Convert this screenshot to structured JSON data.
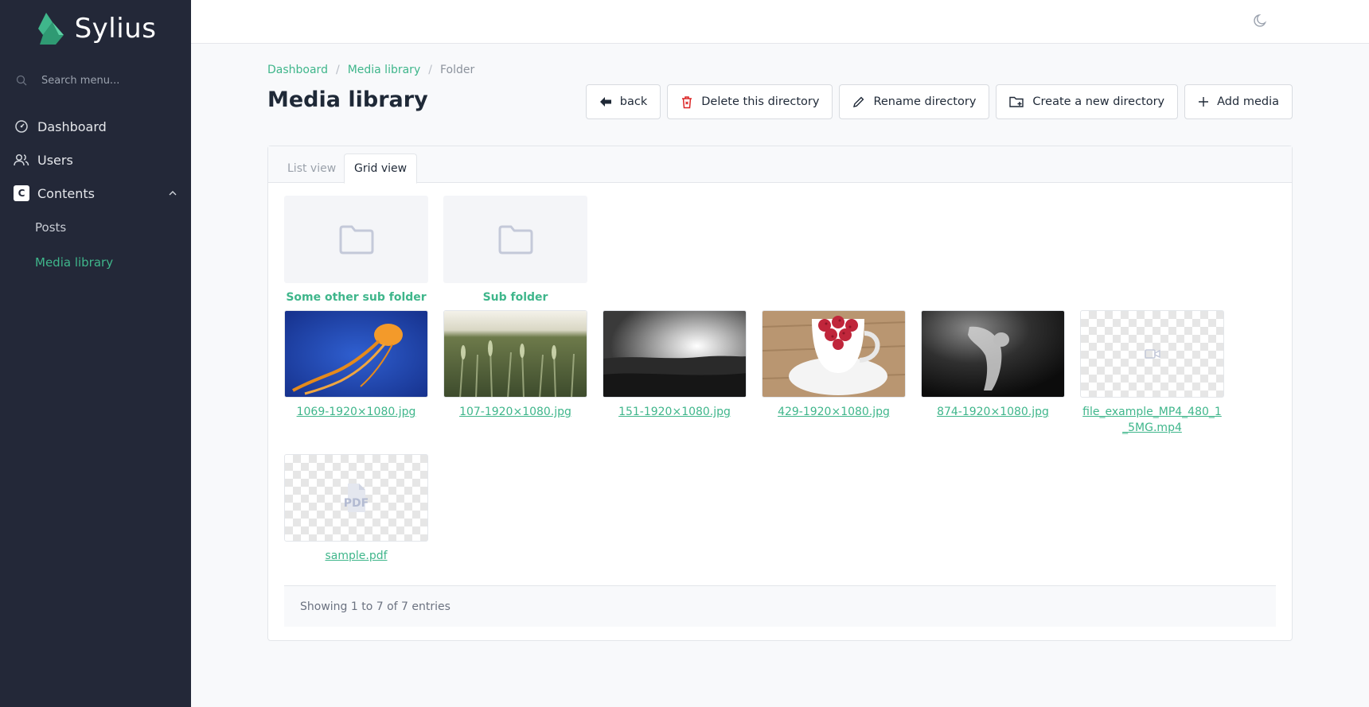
{
  "app": {
    "name": "Sylius"
  },
  "sidebar": {
    "search_placeholder": "Search menu...",
    "items": [
      {
        "label": "Dashboard"
      },
      {
        "label": "Users"
      },
      {
        "label": "Contents"
      }
    ],
    "contents_badge": "C",
    "sub_items": [
      {
        "label": "Posts"
      },
      {
        "label": "Media library"
      }
    ]
  },
  "breadcrumb": {
    "items": [
      "Dashboard",
      "Media library",
      "Folder"
    ],
    "separator": "/"
  },
  "page": {
    "title": "Media library"
  },
  "actions": {
    "back": "back",
    "delete": "Delete this directory",
    "rename": "Rename directory",
    "create": "Create a new directory",
    "add": "Add media"
  },
  "tabs": {
    "list": "List view",
    "grid": "Grid view"
  },
  "folders": [
    {
      "name": "Some other sub folder"
    },
    {
      "name": "Sub folder"
    }
  ],
  "files": [
    {
      "name": "1069-1920×1080.jpg",
      "image": "jellyfish"
    },
    {
      "name": "107-1920×1080.jpg",
      "image": "wheat-field"
    },
    {
      "name": "151-1920×1080.jpg",
      "image": "bw-landscape"
    },
    {
      "name": "429-1920×1080.jpg",
      "image": "raspberries-cup"
    },
    {
      "name": "874-1920×1080.jpg",
      "image": "bw-underwater"
    },
    {
      "name": "file_example_MP4_480_1_5MG.mp4",
      "image": "video-icon"
    },
    {
      "name": "sample.pdf",
      "image": "pdf-icon"
    }
  ],
  "pdf_icon_text": "PDF",
  "pagination": {
    "summary": "Showing 1 to 7 of 7 entries"
  },
  "colors": {
    "accent": "#3fb68b",
    "sidebar_bg": "#232838",
    "delete_icon": "#dc2626"
  }
}
